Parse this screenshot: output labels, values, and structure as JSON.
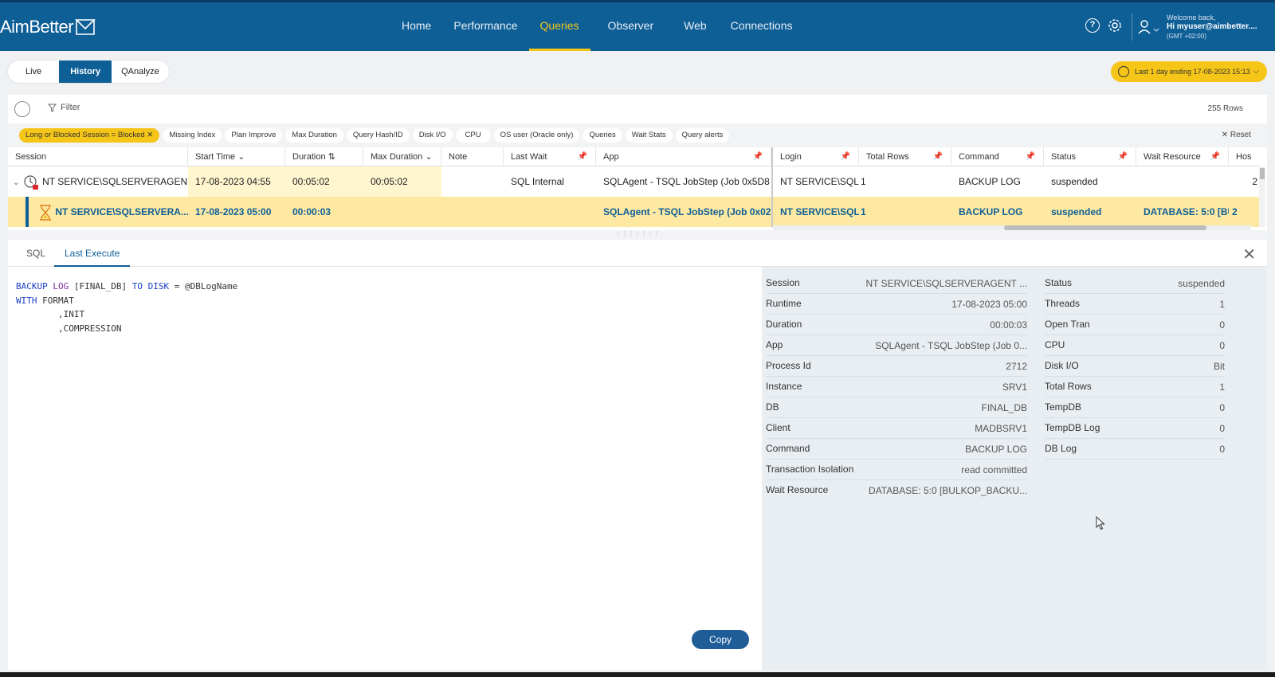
{
  "brand": {
    "logo_text": "AimBetter"
  },
  "nav": {
    "items": [
      "Home",
      "Performance",
      "Queries",
      "Observer",
      "Web",
      "Connections"
    ],
    "active": "Queries"
  },
  "user": {
    "welcome": "Welcome back,",
    "name": "Hi myuser@aimbetter....",
    "tz": "(GMT +02:00)"
  },
  "modes": {
    "live": "Live",
    "history": "History",
    "qanalyze": "QAnalyze"
  },
  "time_range": {
    "label": "Last 1 day ending  17-08-2023 15:13"
  },
  "toolbar": {
    "filter_label": "Filter",
    "rows": "255 Rows",
    "reset": "Reset"
  },
  "chips": {
    "active": "Long or Blocked Session = Blocked",
    "others": [
      "Missing Index",
      "Plan Improve",
      "Max Duration",
      "Query Hash/ID",
      "Disk I/O",
      "CPU",
      "OS user (Oracle only)",
      "Queries",
      "Wait Stats",
      "Query alerts"
    ]
  },
  "columns": {
    "session": "Session",
    "start": "Start Time",
    "duration": "Duration",
    "max_duration": "Max Duration",
    "note": "Note",
    "last_wait": "Last Wait",
    "app": "App",
    "login": "Login",
    "total_rows": "Total Rows",
    "command": "Command",
    "status": "Status",
    "wait_resource": "Wait Resource",
    "host": "Hos"
  },
  "rows": [
    {
      "session": "NT SERVICE\\SQLSERVERAGEN...",
      "start": "17-08-2023 04:55",
      "duration": "00:05:02",
      "max_duration": "00:05:02",
      "note": "",
      "last_wait": "SQL Internal",
      "app": "SQLAgent - TSQL JobStep (Job 0x5D8",
      "login": "NT SERVICE\\SQLSEI",
      "total_rows": "1",
      "command": "BACKUP LOG",
      "status": "suspended",
      "wait_resource": "",
      "host": "2"
    },
    {
      "session": "NT SERVICE\\SQLSERVERA...",
      "start": "17-08-2023 05:00",
      "duration": "00:00:03",
      "max_duration": "",
      "note": "",
      "last_wait": "",
      "app": "SQLAgent - TSQL JobStep (Job 0x02E",
      "login": "NT SERVICE\\SQLSEI",
      "total_rows": "1",
      "command": "BACKUP LOG",
      "status": "suspended",
      "wait_resource": "DATABASE: 5:0 [BUL",
      "host": "2"
    }
  ],
  "bottom_tabs": {
    "sql": "SQL",
    "last_execute": "Last Execute"
  },
  "sql": {
    "l1_kw1": "BACKUP",
    "l1_kw2": "LOG",
    "l1_db": " [FINAL_DB] ",
    "l1_kw3": "TO DISK",
    "l1_rest": " = @DBLogName",
    "l2_kw": "WITH",
    "l2_rest": " FORMAT",
    "l3": "        ,INIT",
    "l4": "        ,COMPRESSION"
  },
  "copy_button": "Copy",
  "details_left": [
    {
      "k": "Session",
      "v": "NT SERVICE\\SQLSERVERAGENT ..."
    },
    {
      "k": "Runtime",
      "v": "17-08-2023 05:00"
    },
    {
      "k": "Duration",
      "v": "00:00:03"
    },
    {
      "k": "App",
      "v": "SQLAgent - TSQL JobStep (Job 0..."
    },
    {
      "k": "Process Id",
      "v": "2712"
    },
    {
      "k": "Instance",
      "v": "SRV1"
    },
    {
      "k": "DB",
      "v": "FINAL_DB"
    },
    {
      "k": "Client",
      "v": "MADBSRV1"
    },
    {
      "k": "Command",
      "v": "BACKUP LOG"
    },
    {
      "k": "Transaction Isolation",
      "v": "read committed"
    },
    {
      "k": "Wait Resource",
      "v": "DATABASE: 5:0 [BULKOP_BACKU..."
    }
  ],
  "details_right": [
    {
      "k": "Status",
      "v": "suspended"
    },
    {
      "k": "Threads",
      "v": "1"
    },
    {
      "k": "Open Tran",
      "v": "0"
    },
    {
      "k": "CPU",
      "v": "0"
    },
    {
      "k": "Disk I/O",
      "v": "Bit"
    },
    {
      "k": "Total Rows",
      "v": "1"
    },
    {
      "k": "TempDB",
      "v": "0"
    },
    {
      "k": "TempDB Log",
      "v": "0"
    },
    {
      "k": "DB Log",
      "v": "0"
    }
  ],
  "colors": {
    "brand": "#0f5f97",
    "accent": "#f5c518",
    "highlight_row": "#fde9a2"
  }
}
